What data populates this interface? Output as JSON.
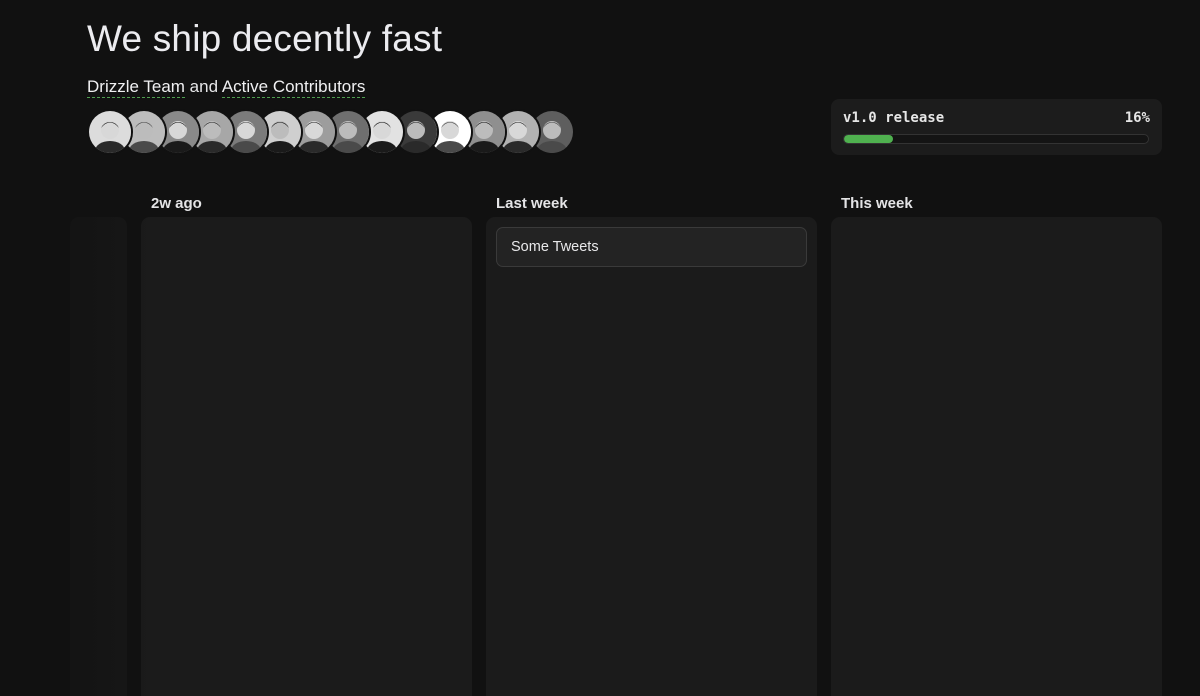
{
  "page": {
    "title": "We ship decently fast",
    "subtitle": {
      "team_link": "Drizzle Team",
      "joiner": " and ",
      "contributors_link": "Active Contributors"
    }
  },
  "avatars": [
    {
      "name": "contributor-1",
      "shade": "#dcdcdc"
    },
    {
      "name": "contributor-2",
      "shade": "#bdbdbd"
    },
    {
      "name": "contributor-3",
      "shade": "#8a8a8a"
    },
    {
      "name": "contributor-4",
      "shade": "#a7a7a7"
    },
    {
      "name": "contributor-5",
      "shade": "#7b7b7b"
    },
    {
      "name": "contributor-6",
      "shade": "#cfcfcf"
    },
    {
      "name": "contributor-7",
      "shade": "#9d9d9d"
    },
    {
      "name": "contributor-8",
      "shade": "#6f6f6f"
    },
    {
      "name": "contributor-9",
      "shade": "#e2e2e2"
    },
    {
      "name": "contributor-10",
      "shade": "#3a3a3a"
    },
    {
      "name": "contributor-11",
      "shade": "#ffffff"
    },
    {
      "name": "contributor-12",
      "shade": "#8f8f8f"
    },
    {
      "name": "contributor-13",
      "shade": "#b2b2b2"
    },
    {
      "name": "contributor-14",
      "shade": "#5e5e5e"
    }
  ],
  "release": {
    "label": "v1.0 release",
    "percent_text": "16%",
    "progress": 0.16,
    "accent": "#4fb14f"
  },
  "columns": [
    {
      "header": "",
      "cards": []
    },
    {
      "header": "2w ago",
      "cards": []
    },
    {
      "header": "Last week",
      "cards": [
        "Some Tweets"
      ]
    },
    {
      "header": "This week",
      "cards": []
    }
  ]
}
